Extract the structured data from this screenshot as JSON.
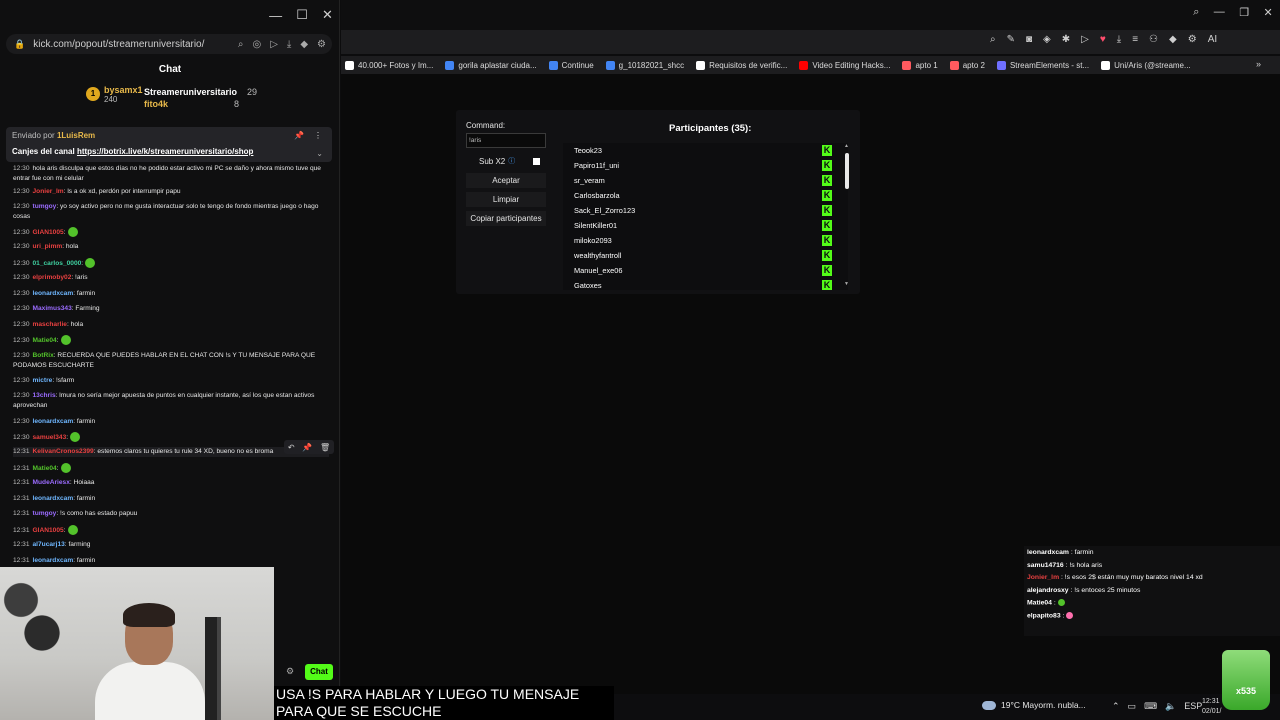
{
  "chat_window": {
    "url": "kick.com/popout/streameruniversitario/",
    "title": "Chat",
    "win_controls": [
      "—",
      "☐",
      "✕"
    ],
    "leaderboard": [
      {
        "name": "bysamx1",
        "value": "240",
        "badge": "1"
      },
      {
        "name": "Streameruniversitario",
        "value": "29"
      },
      {
        "name": "fito4k",
        "value": "8"
      }
    ],
    "pinned": {
      "by_prefix": "Enviado por",
      "by_user": "1LuisRem",
      "text_prefix": "Canjes del canal",
      "link": "https://botrix.live/k/streameruniversitario/shop"
    },
    "messages": [
      {
        "time": "12:30",
        "user": "",
        "color": "#ff5c5c",
        "text": "hola aris disculpa que estos días no he podido estar activo mi PC se daño y ahora mismo tuve que entrar fue con mi celular"
      },
      {
        "time": "12:30",
        "user": "Jonier_lm",
        "color": "#e84040",
        "text": ": ls a ok xd, perdón por interrumpir papu"
      },
      {
        "time": "12:30",
        "user": "tumgoy",
        "color": "#9b6cff",
        "text": ": yo soy activo pero no me gusta interactuar solo te tengo de fondo mientras juego o hago cosas"
      },
      {
        "time": "12:30",
        "user": "GIAN1005",
        "color": "#e84040",
        "text": ":"
      },
      {
        "time": "12:30",
        "user": "uri_pimm",
        "color": "#e84040",
        "text": ": hola"
      },
      {
        "time": "12:30",
        "user": "01_carlos_0000",
        "color": "#3fd0a0",
        "text": ":"
      },
      {
        "time": "12:30",
        "user": "elprimoby02",
        "color": "#e84040",
        "text": ": !aris"
      },
      {
        "time": "12:30",
        "user": "leonardxcam",
        "color": "#6fb7ff",
        "text": ": farmin"
      },
      {
        "time": "12:30",
        "user": "Maximus343",
        "color": "#9b6cff",
        "text": ": Farming"
      },
      {
        "time": "12:30",
        "user": "mascharlie",
        "color": "#e84040",
        "text": ": hola"
      },
      {
        "time": "12:30",
        "user": "Matie04",
        "color": "#53c22b",
        "text": ":"
      },
      {
        "time": "12:30",
        "user": "BotRix",
        "color": "#53c22b",
        "text": ": RECUERDA QUE PUEDES HABLAR EN EL CHAT CON !s Y TU MENSAJE PARA QUE PODAMOS ESCUCHARTE"
      },
      {
        "time": "12:30",
        "user": "mictre",
        "color": "#6fb7ff",
        "text": ": !sfarm"
      },
      {
        "time": "12:30",
        "user": "13chris",
        "color": "#9b6cff",
        "text": ": lmura no sería mejor apuesta de puntos en cualquier instante, así los que estan activos aprovechan"
      },
      {
        "time": "12:30",
        "user": "leonardxcam",
        "color": "#6fb7ff",
        "text": ": farmin"
      },
      {
        "time": "12:30",
        "user": "samuel343",
        "color": "#e84040",
        "text": ":"
      },
      {
        "time": "12:31",
        "user": "KelivanCronos2399",
        "color": "#e84040",
        "text": ": estemos claros tu quieres tu rule 34 XD, bueno no es broma"
      },
      {
        "time": "12:31",
        "user": "Matie04",
        "color": "#53c22b",
        "text": ":"
      },
      {
        "time": "12:31",
        "user": "MudeAriesx",
        "color": "#9b6cff",
        "text": ": Hoiaaa"
      },
      {
        "time": "12:31",
        "user": "leonardxcam",
        "color": "#6fb7ff",
        "text": ": farmin"
      },
      {
        "time": "12:31",
        "user": "tumgoy",
        "color": "#9b6cff",
        "text": ": !s como has estado papuu"
      },
      {
        "time": "12:31",
        "user": "GIAN1005",
        "color": "#e84040",
        "text": ":"
      },
      {
        "time": "12:31",
        "user": "al7ucarj13",
        "color": "#6fb7ff",
        "text": ": farming"
      },
      {
        "time": "12:31",
        "user": "leonardxcam",
        "color": "#6fb7ff",
        "text": ": farmin"
      }
    ],
    "chat_button": "Chat"
  },
  "browser": {
    "bookmarks": [
      {
        "label": "40.000+ Fotos y Im...",
        "color": "#ffffff"
      },
      {
        "label": "gorila aplastar ciuda...",
        "color": "#4285f4"
      },
      {
        "label": "Continue",
        "color": "#4285f4"
      },
      {
        "label": "g_10182021_shcc",
        "color": "#4285f4"
      },
      {
        "label": "Requisitos de verific...",
        "color": "#ffffff"
      },
      {
        "label": "Video Editing Hacks...",
        "color": "#ff0000"
      },
      {
        "label": "apto 1",
        "color": "#ff5a5f"
      },
      {
        "label": "apto 2",
        "color": "#ff5a5f"
      },
      {
        "label": "StreamElements - st...",
        "color": "#6f6fff"
      },
      {
        "label": "Uni/Aris (@streame...",
        "color": "#ffffff"
      }
    ]
  },
  "widget": {
    "command_label": "Command:",
    "command_value": "!aris",
    "sub_x2_label": "Sub X2",
    "accept": "Aceptar",
    "clear": "Limpiar",
    "copy": "Copiar participantes",
    "participants_title": "Participantes (35):",
    "participants": [
      "Teook23",
      "Papiro11f_uni",
      "sr_veram",
      "Carlosbarzola",
      "Sack_El_Zorro123",
      "SilentKiller01",
      "miloko2093",
      "wealthyfantroll",
      "Manuel_exe06",
      "Gatoxes"
    ]
  },
  "overlay_chat": [
    {
      "user": "leonardxcam",
      "text": " : farmin"
    },
    {
      "user": "samu14716",
      "text": " : !s hola aris"
    },
    {
      "user": "Jonier_lm",
      "text": " : !s esos 2$ están muy muy baratos nivel 14 xd"
    },
    {
      "user": "alejandrosxy",
      "text": " : !s entoces 25 minutos"
    },
    {
      "user": "Matie04",
      "text": " :"
    },
    {
      "user": "elpapito83",
      "text": " :"
    }
  ],
  "subtitles": "USA !S PARA HABLAR Y LUEGO TU MENSAJE PARA QUE SE ESCUCHE",
  "taskbar": {
    "weather": "19°C  Mayorm. nubla...",
    "lang": "ESP",
    "time": "12:31",
    "date": "02/01/"
  },
  "cup_text": "x535"
}
